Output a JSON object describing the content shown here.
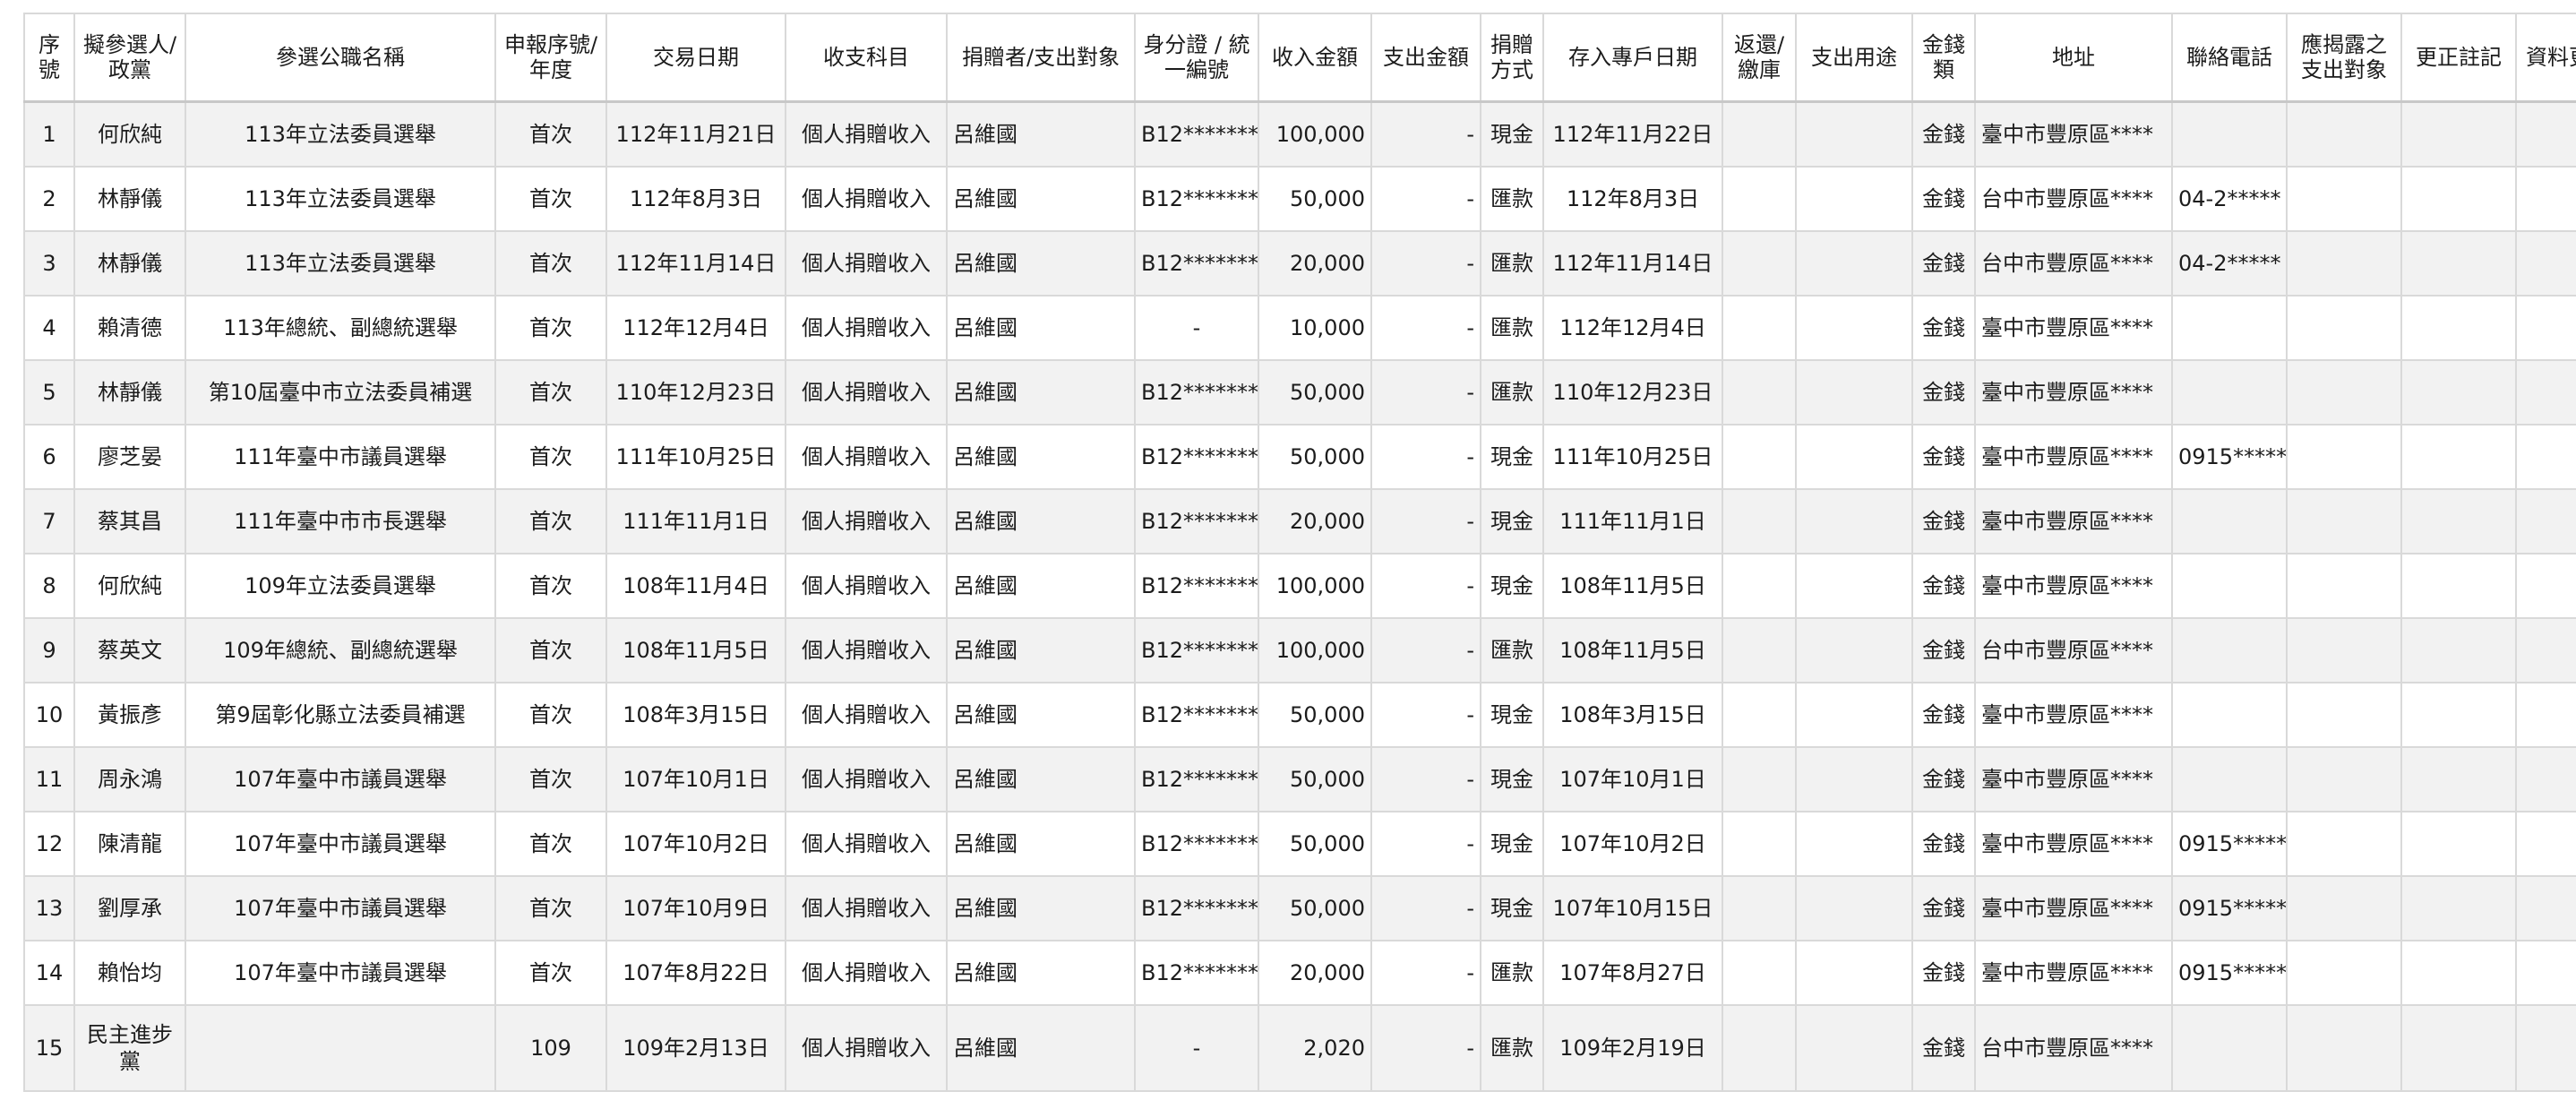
{
  "table": {
    "headers": {
      "seq": "序號",
      "candidate": "擬參選人/政黨",
      "office": "參選公職名稱",
      "report": "申報序號/年度",
      "tx_date": "交易日期",
      "category": "收支科目",
      "donor": "捐贈者/支出對象",
      "id": "身分證 / 統一編號",
      "income": "收入金額",
      "expense": "支出金額",
      "method": "捐贈方式",
      "deposit_date": "存入專戶日期",
      "returned": "返還/繳庫",
      "purpose": "支出用途",
      "money_type": "金錢類",
      "address": "地址",
      "phone": "聯絡電話",
      "disclose": "應揭露之支出對象",
      "correction": "更正註記",
      "data": "資料更正"
    },
    "rows": [
      {
        "seq": "1",
        "candidate": "何欣純",
        "office": "113年立法委員選舉",
        "report": "首次",
        "tx_date": "112年11月21日",
        "category": "個人捐贈收入",
        "donor": "呂維國",
        "id": "B12*******",
        "income": "100,000",
        "expense": "-",
        "method": "現金",
        "deposit_date": "112年11月22日",
        "returned": "",
        "purpose": "",
        "money_type": "金錢",
        "address": "臺中市豐原區****",
        "phone": "",
        "disclose": "",
        "correction": "",
        "data": ""
      },
      {
        "seq": "2",
        "candidate": "林靜儀",
        "office": "113年立法委員選舉",
        "report": "首次",
        "tx_date": "112年8月3日",
        "category": "個人捐贈收入",
        "donor": "呂維國",
        "id": "B12*******",
        "income": "50,000",
        "expense": "-",
        "method": "匯款",
        "deposit_date": "112年8月3日",
        "returned": "",
        "purpose": "",
        "money_type": "金錢",
        "address": "台中市豐原區****",
        "phone": "04-2*****",
        "disclose": "",
        "correction": "",
        "data": ""
      },
      {
        "seq": "3",
        "candidate": "林靜儀",
        "office": "113年立法委員選舉",
        "report": "首次",
        "tx_date": "112年11月14日",
        "category": "個人捐贈收入",
        "donor": "呂維國",
        "id": "B12*******",
        "income": "20,000",
        "expense": "-",
        "method": "匯款",
        "deposit_date": "112年11月14日",
        "returned": "",
        "purpose": "",
        "money_type": "金錢",
        "address": "台中市豐原區****",
        "phone": "04-2*****",
        "disclose": "",
        "correction": "",
        "data": ""
      },
      {
        "seq": "4",
        "candidate": "賴清德",
        "office": "113年總統、副總統選舉",
        "report": "首次",
        "tx_date": "112年12月4日",
        "category": "個人捐贈收入",
        "donor": "呂維國",
        "id": "-",
        "income": "10,000",
        "expense": "-",
        "method": "匯款",
        "deposit_date": "112年12月4日",
        "returned": "",
        "purpose": "",
        "money_type": "金錢",
        "address": "臺中市豐原區****",
        "phone": "",
        "disclose": "",
        "correction": "",
        "data": ""
      },
      {
        "seq": "5",
        "candidate": "林靜儀",
        "office": "第10屆臺中市立法委員補選",
        "report": "首次",
        "tx_date": "110年12月23日",
        "category": "個人捐贈收入",
        "donor": "呂維國",
        "id": "B12*******",
        "income": "50,000",
        "expense": "-",
        "method": "匯款",
        "deposit_date": "110年12月23日",
        "returned": "",
        "purpose": "",
        "money_type": "金錢",
        "address": "臺中市豐原區****",
        "phone": "",
        "disclose": "",
        "correction": "",
        "data": ""
      },
      {
        "seq": "6",
        "candidate": "廖芝晏",
        "office": "111年臺中市議員選舉",
        "report": "首次",
        "tx_date": "111年10月25日",
        "category": "個人捐贈收入",
        "donor": "呂維國",
        "id": "B12*******",
        "income": "50,000",
        "expense": "-",
        "method": "現金",
        "deposit_date": "111年10月25日",
        "returned": "",
        "purpose": "",
        "money_type": "金錢",
        "address": "臺中市豐原區****",
        "phone": "0915*****",
        "disclose": "",
        "correction": "",
        "data": ""
      },
      {
        "seq": "7",
        "candidate": "蔡其昌",
        "office": "111年臺中市市長選舉",
        "report": "首次",
        "tx_date": "111年11月1日",
        "category": "個人捐贈收入",
        "donor": "呂維國",
        "id": "B12*******",
        "income": "20,000",
        "expense": "-",
        "method": "現金",
        "deposit_date": "111年11月1日",
        "returned": "",
        "purpose": "",
        "money_type": "金錢",
        "address": "臺中市豐原區****",
        "phone": "",
        "disclose": "",
        "correction": "",
        "data": ""
      },
      {
        "seq": "8",
        "candidate": "何欣純",
        "office": "109年立法委員選舉",
        "report": "首次",
        "tx_date": "108年11月4日",
        "category": "個人捐贈收入",
        "donor": "呂維國",
        "id": "B12*******",
        "income": "100,000",
        "expense": "-",
        "method": "現金",
        "deposit_date": "108年11月5日",
        "returned": "",
        "purpose": "",
        "money_type": "金錢",
        "address": "臺中市豐原區****",
        "phone": "",
        "disclose": "",
        "correction": "",
        "data": ""
      },
      {
        "seq": "9",
        "candidate": "蔡英文",
        "office": "109年總統、副總統選舉",
        "report": "首次",
        "tx_date": "108年11月5日",
        "category": "個人捐贈收入",
        "donor": "呂維國",
        "id": "B12*******",
        "income": "100,000",
        "expense": "-",
        "method": "匯款",
        "deposit_date": "108年11月5日",
        "returned": "",
        "purpose": "",
        "money_type": "金錢",
        "address": "台中市豐原區****",
        "phone": "",
        "disclose": "",
        "correction": "",
        "data": ""
      },
      {
        "seq": "10",
        "candidate": "黃振彥",
        "office": "第9屆彰化縣立法委員補選",
        "report": "首次",
        "tx_date": "108年3月15日",
        "category": "個人捐贈收入",
        "donor": "呂維國",
        "id": "B12*******",
        "income": "50,000",
        "expense": "-",
        "method": "現金",
        "deposit_date": "108年3月15日",
        "returned": "",
        "purpose": "",
        "money_type": "金錢",
        "address": "臺中市豐原區****",
        "phone": "",
        "disclose": "",
        "correction": "",
        "data": ""
      },
      {
        "seq": "11",
        "candidate": "周永鴻",
        "office": "107年臺中市議員選舉",
        "report": "首次",
        "tx_date": "107年10月1日",
        "category": "個人捐贈收入",
        "donor": "呂維國",
        "id": "B12*******",
        "income": "50,000",
        "expense": "-",
        "method": "現金",
        "deposit_date": "107年10月1日",
        "returned": "",
        "purpose": "",
        "money_type": "金錢",
        "address": "臺中市豐原區****",
        "phone": "",
        "disclose": "",
        "correction": "",
        "data": ""
      },
      {
        "seq": "12",
        "candidate": "陳清龍",
        "office": "107年臺中市議員選舉",
        "report": "首次",
        "tx_date": "107年10月2日",
        "category": "個人捐贈收入",
        "donor": "呂維國",
        "id": "B12*******",
        "income": "50,000",
        "expense": "-",
        "method": "現金",
        "deposit_date": "107年10月2日",
        "returned": "",
        "purpose": "",
        "money_type": "金錢",
        "address": "臺中市豐原區****",
        "phone": "0915*****",
        "disclose": "",
        "correction": "",
        "data": ""
      },
      {
        "seq": "13",
        "candidate": "劉厚承",
        "office": "107年臺中市議員選舉",
        "report": "首次",
        "tx_date": "107年10月9日",
        "category": "個人捐贈收入",
        "donor": "呂維國",
        "id": "B12*******",
        "income": "50,000",
        "expense": "-",
        "method": "現金",
        "deposit_date": "107年10月15日",
        "returned": "",
        "purpose": "",
        "money_type": "金錢",
        "address": "臺中市豐原區****",
        "phone": "0915*****",
        "disclose": "",
        "correction": "",
        "data": ""
      },
      {
        "seq": "14",
        "candidate": "賴怡均",
        "office": "107年臺中市議員選舉",
        "report": "首次",
        "tx_date": "107年8月22日",
        "category": "個人捐贈收入",
        "donor": "呂維國",
        "id": "B12*******",
        "income": "20,000",
        "expense": "-",
        "method": "匯款",
        "deposit_date": "107年8月27日",
        "returned": "",
        "purpose": "",
        "money_type": "金錢",
        "address": "臺中市豐原區****",
        "phone": "0915*****",
        "disclose": "",
        "correction": "",
        "data": ""
      },
      {
        "seq": "15",
        "candidate": "民主進步黨",
        "office": "",
        "report": "109",
        "tx_date": "109年2月13日",
        "category": "個人捐贈收入",
        "donor": "呂維國",
        "id": "-",
        "income": "2,020",
        "expense": "-",
        "method": "匯款",
        "deposit_date": "109年2月19日",
        "returned": "",
        "purpose": "",
        "money_type": "金錢",
        "address": "台中市豐原區****",
        "phone": "",
        "disclose": "",
        "correction": "",
        "data": ""
      }
    ]
  }
}
